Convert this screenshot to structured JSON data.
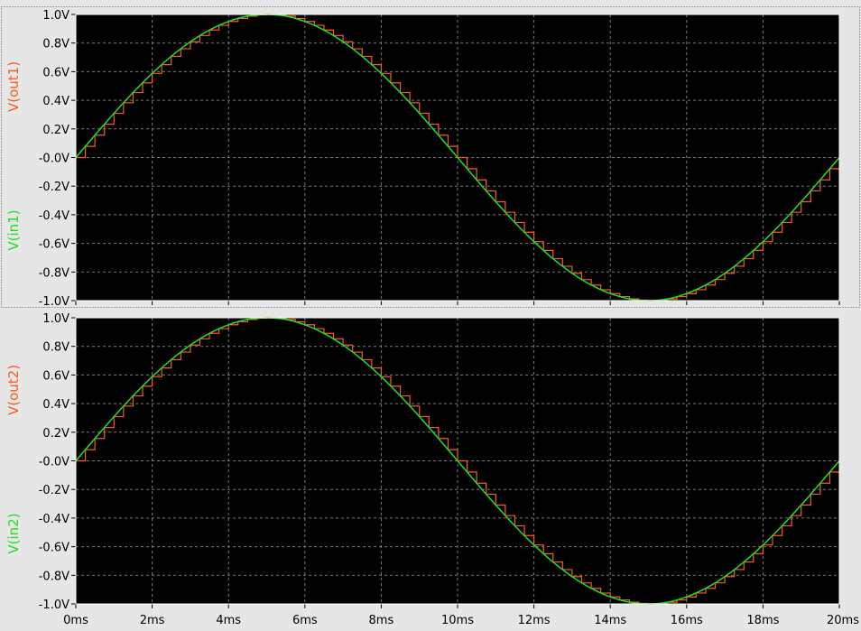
{
  "chart_data": [
    {
      "type": "line",
      "panel": "top",
      "x_unit": "ms",
      "y_unit": "V",
      "xlim": [
        0,
        20
      ],
      "ylim": [
        -1.0,
        1.0
      ],
      "x_ticks": [
        "0ms",
        "2ms",
        "4ms",
        "6ms",
        "8ms",
        "10ms",
        "12ms",
        "14ms",
        "16ms",
        "18ms",
        "20ms"
      ],
      "y_ticks": [
        "1.0V",
        "0.8V",
        "0.6V",
        "0.4V",
        "0.2V",
        "-0.0V",
        "-0.2V",
        "-0.4V",
        "-0.6V",
        "-0.8V",
        "-1.0V"
      ],
      "grid": true,
      "series": [
        {
          "name": "V(out1)",
          "color": "#ff5a1e",
          "style": "step",
          "step_ms": 0.25,
          "x": [
            0,
            0.25,
            0.5,
            0.75,
            1,
            1.25,
            1.5,
            1.75,
            2,
            2.25,
            2.5,
            2.75,
            3,
            3.25,
            3.5,
            3.75,
            4,
            4.25,
            4.5,
            4.75,
            5,
            5.25,
            5.5,
            5.75,
            6,
            6.25,
            6.5,
            6.75,
            7,
            7.25,
            7.5,
            7.75,
            8,
            8.25,
            8.5,
            8.75,
            9,
            9.25,
            9.5,
            9.75,
            10,
            10.25,
            10.5,
            10.75,
            11,
            11.25,
            11.5,
            11.75,
            12,
            12.25,
            12.5,
            12.75,
            13,
            13.25,
            13.5,
            13.75,
            14,
            14.25,
            14.5,
            14.75,
            15,
            15.25,
            15.5,
            15.75,
            16,
            16.25,
            16.5,
            16.75,
            17,
            17.25,
            17.5,
            17.75,
            18,
            18.25,
            18.5,
            18.75,
            19,
            19.25,
            19.5,
            19.75
          ],
          "y": [
            0,
            0.078,
            0.156,
            0.233,
            0.309,
            0.383,
            0.454,
            0.522,
            0.588,
            0.649,
            0.707,
            0.76,
            0.809,
            0.853,
            0.891,
            0.924,
            0.951,
            0.972,
            0.988,
            0.997,
            1.0,
            0.997,
            0.988,
            0.972,
            0.951,
            0.924,
            0.891,
            0.853,
            0.809,
            0.76,
            0.707,
            0.649,
            0.588,
            0.522,
            0.454,
            0.383,
            0.309,
            0.233,
            0.156,
            0.078,
            0,
            -0.078,
            -0.156,
            -0.233,
            -0.309,
            -0.383,
            -0.454,
            -0.522,
            -0.588,
            -0.649,
            -0.707,
            -0.76,
            -0.809,
            -0.853,
            -0.891,
            -0.924,
            -0.951,
            -0.972,
            -0.988,
            -0.997,
            -1.0,
            -0.997,
            -0.988,
            -0.972,
            -0.951,
            -0.924,
            -0.891,
            -0.853,
            -0.809,
            -0.76,
            -0.707,
            -0.649,
            -0.588,
            -0.522,
            -0.454,
            -0.383,
            -0.309,
            -0.233,
            -0.156,
            -0.078
          ]
        },
        {
          "name": "V(in1)",
          "color": "#20e020",
          "style": "line",
          "x": [
            0,
            0.5,
            1,
            1.5,
            2,
            2.5,
            3,
            3.5,
            4,
            4.5,
            5,
            5.5,
            6,
            6.5,
            7,
            7.5,
            8,
            8.5,
            9,
            9.5,
            10,
            10.5,
            11,
            11.5,
            12,
            12.5,
            13,
            13.5,
            14,
            14.5,
            15,
            15.5,
            16,
            16.5,
            17,
            17.5,
            18,
            18.5,
            19,
            19.5,
            20
          ],
          "y": [
            0,
            0.156,
            0.309,
            0.454,
            0.588,
            0.707,
            0.809,
            0.891,
            0.951,
            0.988,
            1.0,
            0.988,
            0.951,
            0.891,
            0.809,
            0.707,
            0.588,
            0.454,
            0.309,
            0.156,
            0,
            -0.156,
            -0.309,
            -0.454,
            -0.588,
            -0.707,
            -0.809,
            -0.891,
            -0.951,
            -0.988,
            -1.0,
            -0.988,
            -0.951,
            -0.891,
            -0.809,
            -0.707,
            -0.588,
            -0.454,
            -0.309,
            -0.156,
            0
          ]
        }
      ]
    },
    {
      "type": "line",
      "panel": "bottom",
      "x_unit": "ms",
      "y_unit": "V",
      "xlim": [
        0,
        20
      ],
      "ylim": [
        -1.0,
        1.0
      ],
      "x_ticks": [
        "0ms",
        "2ms",
        "4ms",
        "6ms",
        "8ms",
        "10ms",
        "12ms",
        "14ms",
        "16ms",
        "18ms",
        "20ms"
      ],
      "y_ticks": [
        "1.0V",
        "0.8V",
        "0.6V",
        "0.4V",
        "0.2V",
        "-0.0V",
        "-0.2V",
        "-0.4V",
        "-0.6V",
        "-0.8V",
        "-1.0V"
      ],
      "grid": true,
      "series": [
        {
          "name": "V(out2)",
          "color": "#ff5a1e",
          "style": "step",
          "step_ms": 0.25,
          "x": [
            0,
            0.25,
            0.5,
            0.75,
            1,
            1.25,
            1.5,
            1.75,
            2,
            2.25,
            2.5,
            2.75,
            3,
            3.25,
            3.5,
            3.75,
            4,
            4.25,
            4.5,
            4.75,
            5,
            5.25,
            5.5,
            5.75,
            6,
            6.25,
            6.5,
            6.75,
            7,
            7.25,
            7.5,
            7.75,
            8,
            8.25,
            8.5,
            8.75,
            9,
            9.25,
            9.5,
            9.75,
            10,
            10.25,
            10.5,
            10.75,
            11,
            11.25,
            11.5,
            11.75,
            12,
            12.25,
            12.5,
            12.75,
            13,
            13.25,
            13.5,
            13.75,
            14,
            14.25,
            14.5,
            14.75,
            15,
            15.25,
            15.5,
            15.75,
            16,
            16.25,
            16.5,
            16.75,
            17,
            17.25,
            17.5,
            17.75,
            18,
            18.25,
            18.5,
            18.75,
            19,
            19.25,
            19.5,
            19.75
          ],
          "y": [
            0,
            0.078,
            0.156,
            0.233,
            0.309,
            0.383,
            0.454,
            0.522,
            0.588,
            0.649,
            0.707,
            0.76,
            0.809,
            0.853,
            0.891,
            0.924,
            0.951,
            0.972,
            0.988,
            0.997,
            1.0,
            0.997,
            0.988,
            0.972,
            0.951,
            0.924,
            0.891,
            0.853,
            0.809,
            0.76,
            0.707,
            0.649,
            0.588,
            0.522,
            0.454,
            0.383,
            0.309,
            0.233,
            0.156,
            0.078,
            0,
            -0.078,
            -0.156,
            -0.233,
            -0.309,
            -0.383,
            -0.454,
            -0.522,
            -0.588,
            -0.649,
            -0.707,
            -0.76,
            -0.809,
            -0.853,
            -0.891,
            -0.924,
            -0.951,
            -0.972,
            -0.988,
            -0.997,
            -1.0,
            -0.997,
            -0.988,
            -0.972,
            -0.951,
            -0.924,
            -0.891,
            -0.853,
            -0.809,
            -0.76,
            -0.707,
            -0.649,
            -0.588,
            -0.522,
            -0.454,
            -0.383,
            -0.309,
            -0.233,
            -0.156,
            -0.078
          ]
        },
        {
          "name": "V(in2)",
          "color": "#20e020",
          "style": "line",
          "x": [
            0,
            0.5,
            1,
            1.5,
            2,
            2.5,
            3,
            3.5,
            4,
            4.5,
            5,
            5.5,
            6,
            6.5,
            7,
            7.5,
            8,
            8.5,
            9,
            9.5,
            10,
            10.5,
            11,
            11.5,
            12,
            12.5,
            13,
            13.5,
            14,
            14.5,
            15,
            15.5,
            16,
            16.5,
            17,
            17.5,
            18,
            18.5,
            19,
            19.5,
            20
          ],
          "y": [
            0,
            0.156,
            0.309,
            0.454,
            0.588,
            0.707,
            0.809,
            0.891,
            0.951,
            0.988,
            1.0,
            0.988,
            0.951,
            0.891,
            0.809,
            0.707,
            0.588,
            0.454,
            0.309,
            0.156,
            0,
            -0.156,
            -0.309,
            -0.454,
            -0.588,
            -0.707,
            -0.809,
            -0.891,
            -0.951,
            -0.988,
            -1.0,
            -0.988,
            -0.951,
            -0.891,
            -0.809,
            -0.707,
            -0.588,
            -0.454,
            -0.309,
            -0.156,
            0
          ]
        }
      ]
    }
  ],
  "colors": {
    "plot_background": "#000000",
    "window_background": "#e6e6e6",
    "grid": "#7a7a7a",
    "frame": "#ffffff"
  }
}
